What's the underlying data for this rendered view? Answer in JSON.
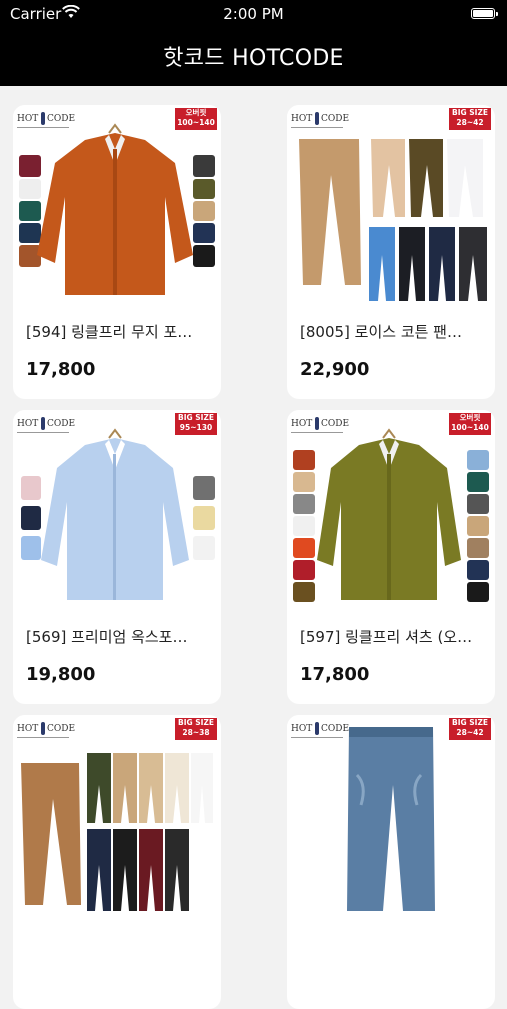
{
  "status": {
    "carrier": "Carrier",
    "time": "2:00 PM"
  },
  "header": {
    "title": "핫코드 HOTCODE"
  },
  "brand": {
    "logo_left": "HOT",
    "logo_right": "CODE"
  },
  "products": [
    {
      "name": "[594] 링클프리 무지 포…",
      "price": "17,800",
      "badge_line1": "오버핏",
      "badge_line2": "100~140",
      "image": "orange-shirt"
    },
    {
      "name": "[8005] 로이스 코튼 팬…",
      "price": "22,900",
      "badge_line1": "BIG SIZE",
      "badge_line2": "28~42",
      "image": "cotton-pants"
    },
    {
      "name": "[569] 프리미엄 옥스포…",
      "price": "19,800",
      "badge_line1": "BIG SIZE",
      "badge_line2": "95~130",
      "image": "blue-oxford-shirt"
    },
    {
      "name": "[597] 링클프리 셔츠 (오…",
      "price": "17,800",
      "badge_line1": "오버핏",
      "badge_line2": "100~140",
      "image": "olive-shirt"
    },
    {
      "name": "",
      "price": "",
      "badge_line1": "BIG SIZE",
      "badge_line2": "28~38",
      "image": "brown-pants"
    },
    {
      "name": "",
      "price": "",
      "badge_line1": "BIG SIZE",
      "badge_line2": "28~42",
      "image": "denim-jeans"
    }
  ],
  "colors": {
    "header_bg": "#000000",
    "badge_red": "#c81e2a",
    "page_bg": "#f2f2f2"
  }
}
